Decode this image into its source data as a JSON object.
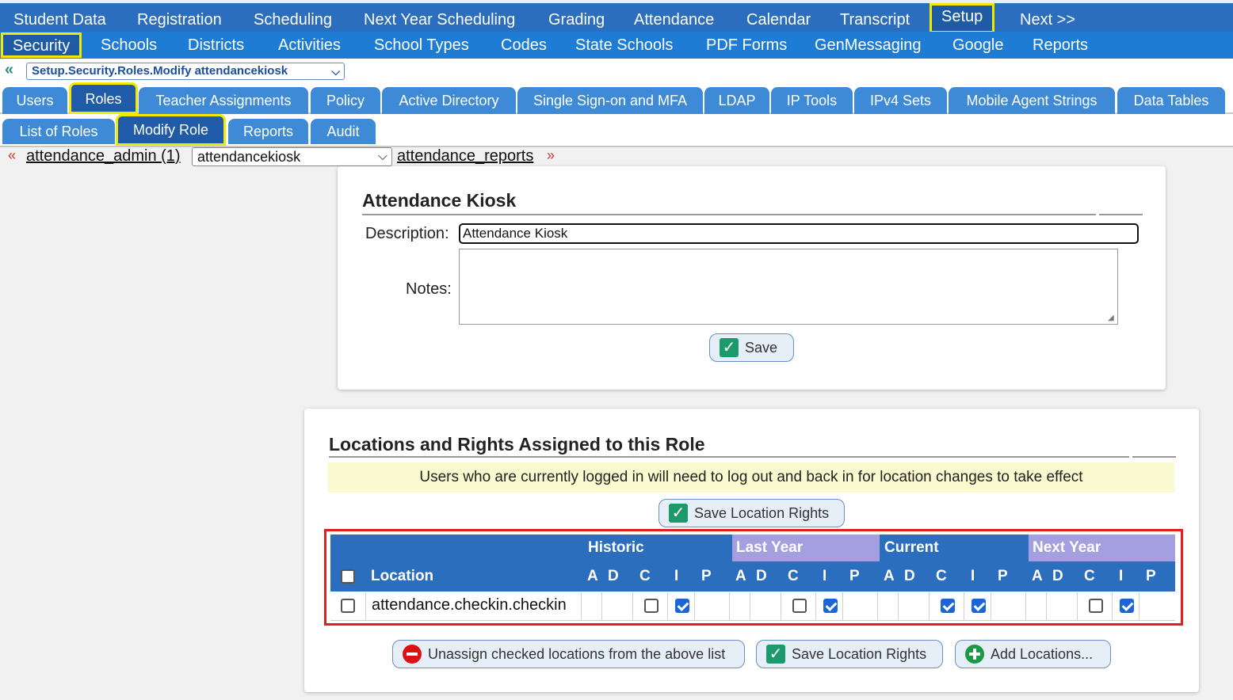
{
  "top_nav": [
    "Student Data",
    "Registration",
    "Scheduling",
    "Next Year Scheduling",
    "Grading",
    "Attendance",
    "Calendar",
    "Transcript",
    "Setup",
    "Next >>"
  ],
  "sub_nav": [
    "Security",
    "Schools",
    "Districts",
    "Activities",
    "School Types",
    "Codes",
    "State Schools",
    "PDF Forms",
    "GenMessaging",
    "Google",
    "Reports"
  ],
  "breadcrumb": "Setup.Security.Roles.Modify attendancekiosk",
  "tabs1": [
    "Users",
    "Roles",
    "Teacher Assignments",
    "Policy",
    "Active Directory",
    "Single Sign-on and MFA",
    "LDAP",
    "IP Tools",
    "IPv4 Sets",
    "Mobile Agent Strings",
    "Data Tables"
  ],
  "tabs2": [
    "List of Roles",
    "Modify Role",
    "Reports",
    "Audit"
  ],
  "role_nav": {
    "prev": "attendance_admin (1)",
    "current": "attendancekiosk",
    "next": "attendance_reports"
  },
  "role_form": {
    "title": "Attendance Kiosk",
    "description_label": "Description:",
    "description_value": "Attendance Kiosk",
    "notes_label": "Notes:",
    "notes_value": "",
    "save_label": "Save"
  },
  "locations": {
    "title": "Locations and Rights Assigned to this Role",
    "notice": "Users who are currently logged in will need to log out and back in for location changes to take effect",
    "save_rights_label": "Save Location Rights",
    "group_headers": [
      "Historic",
      "Last Year",
      "Current",
      "Next Year"
    ],
    "location_header": "Location",
    "right_letters": [
      "A",
      "D",
      "C",
      "I",
      "P"
    ],
    "rows": [
      {
        "location": "attendance.checkin.checkin",
        "selected": false,
        "rights": [
          [
            false,
            false,
            false,
            true,
            false
          ],
          [
            false,
            false,
            false,
            true,
            false
          ],
          [
            false,
            false,
            true,
            true,
            false
          ],
          [
            false,
            false,
            false,
            true,
            false
          ]
        ]
      }
    ],
    "unassign_label": "Unassign checked locations from the above list",
    "save_rights_label_bottom": "Save Location Rights",
    "add_label": "Add Locations..."
  },
  "colors": {
    "nav_blue": "#2a6ebd",
    "sub_nav_blue": "#1e7cd4",
    "highlight_yellow": "#f2e800",
    "grid_purple": "#a49fe0",
    "redbox": "#e02020"
  },
  "icons": {
    "back": "double-chevron-left-icon",
    "prev": "double-chevron-left-red-icon",
    "next": "double-chevron-right-red-icon",
    "save": "check-icon",
    "unassign": "minus-circle-icon",
    "add": "plus-circle-icon"
  }
}
